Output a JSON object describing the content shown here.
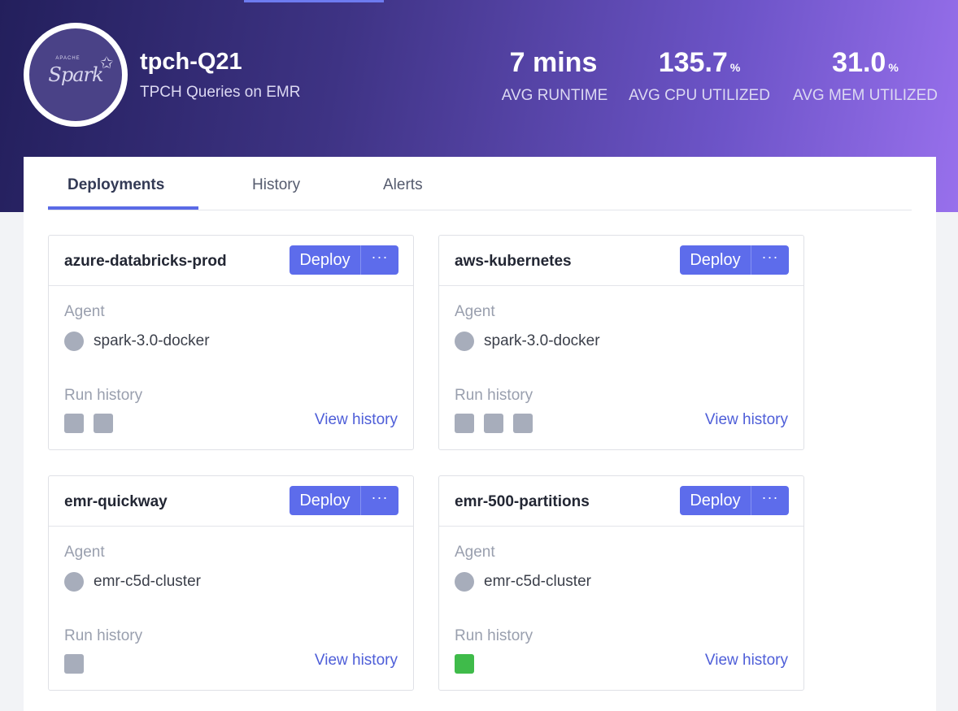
{
  "job": {
    "logo": {
      "apache": "APACHE",
      "text": "Spark"
    },
    "title": "tpch-Q21",
    "subtitle": "TPCH Queries on EMR"
  },
  "stats": [
    {
      "value": "7 mins",
      "unit": "",
      "label": "AVG RUNTIME"
    },
    {
      "value": "135.7",
      "unit": "%",
      "label": "AVG CPU UTILIZED"
    },
    {
      "value": "31.0",
      "unit": "%",
      "label": "AVG MEM UTILIZED"
    }
  ],
  "tabs": [
    {
      "label": "Deployments",
      "active": true
    },
    {
      "label": "History",
      "active": false
    },
    {
      "label": "Alerts",
      "active": false
    }
  ],
  "card_labels": {
    "agent": "Agent",
    "run_history": "Run history",
    "view_history": "View history",
    "deploy": "Deploy",
    "more": "···"
  },
  "deployments": [
    {
      "name": "azure-databricks-prod",
      "agent": "spark-3.0-docker",
      "runs": [
        "neutral",
        "neutral"
      ]
    },
    {
      "name": "aws-kubernetes",
      "agent": "spark-3.0-docker",
      "runs": [
        "neutral",
        "neutral",
        "neutral"
      ]
    },
    {
      "name": "emr-quickway",
      "agent": "emr-c5d-cluster",
      "runs": [
        "neutral"
      ]
    },
    {
      "name": "emr-500-partitions",
      "agent": "emr-c5d-cluster",
      "runs": [
        "success"
      ]
    }
  ],
  "colors": {
    "accent": "#5d6ceb",
    "run_neutral": "#a7adbb",
    "run_success": "#3fbb4a"
  }
}
